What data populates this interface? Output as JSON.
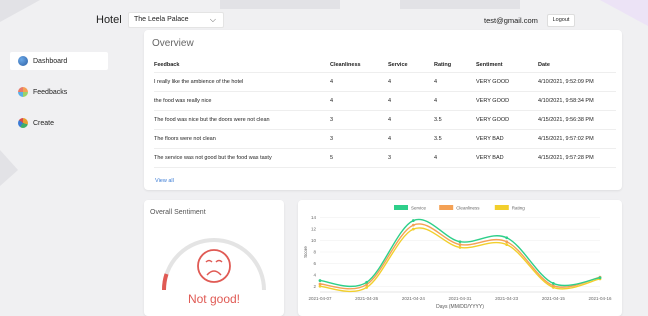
{
  "header": {
    "brand": "Hotel",
    "hotel_selected": "The Leela Palace",
    "user_email": "test@gmail.com",
    "logout_label": "Logout"
  },
  "sidebar": {
    "items": [
      {
        "label": "Dashboard",
        "icon": "dashboard-icon",
        "active": true
      },
      {
        "label": "Feedbacks",
        "icon": "feedbacks-icon",
        "active": false
      },
      {
        "label": "Create",
        "icon": "create-icon",
        "active": false
      }
    ]
  },
  "overview": {
    "title": "Overview",
    "columns": [
      "Feedback",
      "Cleanliness",
      "Service",
      "Rating",
      "Sentiment",
      "Date"
    ],
    "rows": [
      [
        "I really like the ambience of the hotel",
        "4",
        "4",
        "4",
        "VERY GOOD",
        "4/10/2021, 9:52:09 PM"
      ],
      [
        "the food was really nice",
        "4",
        "4",
        "4",
        "VERY GOOD",
        "4/10/2021, 9:58:34 PM"
      ],
      [
        "The food was nice but the doors were not clean",
        "3",
        "4",
        "3.5",
        "VERY GOOD",
        "4/15/2021, 9:56:38 PM"
      ],
      [
        "The floors were not clean",
        "3",
        "4",
        "3.5",
        "VERY BAD",
        "4/15/2021, 9:57:02 PM"
      ],
      [
        "The service was not good but the food was tasty",
        "5",
        "3",
        "4",
        "VERY BAD",
        "4/15/2021, 9:57:28 PM"
      ]
    ],
    "view_all": "View all"
  },
  "sentiment_panel": {
    "title": "Overall Sentiment",
    "text": "Not good!",
    "icon": "sad-face-icon",
    "color": "#e05a54"
  },
  "chart_data": {
    "type": "line",
    "legend_position": "top-center",
    "series": [
      {
        "name": "Service",
        "color": "#2ecf8a",
        "values": [
          3.0,
          2.7,
          13.5,
          9.8,
          10.5,
          2.5,
          3.5
        ]
      },
      {
        "name": "Cleanliness",
        "color": "#f4a155",
        "values": [
          2.4,
          2.3,
          12.7,
          9.3,
          9.8,
          2.1,
          3.6
        ]
      },
      {
        "name": "Rating",
        "color": "#f2cf2c",
        "values": [
          2.0,
          1.8,
          12.0,
          8.8,
          9.3,
          1.8,
          3.3
        ]
      }
    ],
    "categories": [
      "2021-04-07",
      "2021-04-26",
      "2021-04-24",
      "2021-04-31",
      "2021-04-23",
      "2021-04-15",
      "2021-04-16"
    ],
    "y_ticks": [
      2,
      4,
      6,
      8,
      10,
      12,
      14
    ],
    "ylim": [
      1,
      15
    ],
    "xlabel": "Days (MM/DD/YYYY)",
    "ylabel": "Score",
    "grid": true
  }
}
